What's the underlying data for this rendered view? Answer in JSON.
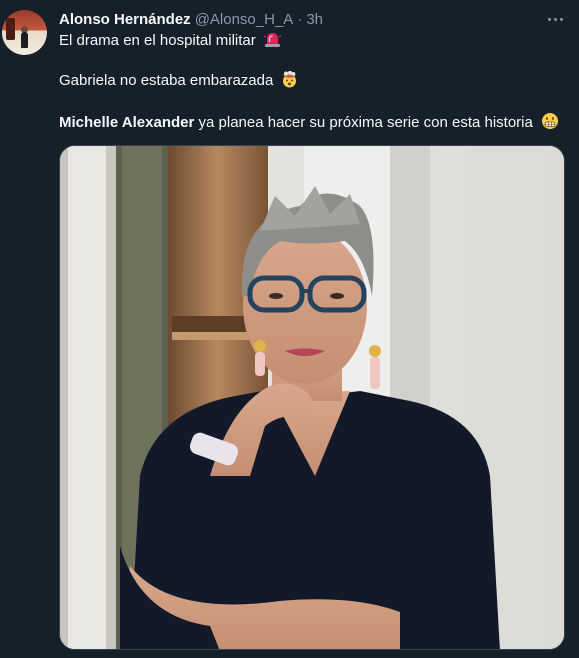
{
  "tweet": {
    "author_name": "Alonso Hernández",
    "handle": "@Alonso_H_A",
    "separator": "·",
    "time": "3h",
    "line1_text": "El drama en el hospital militar",
    "line1_emoji": "police-light-emoji",
    "line2_text": "Gabriela no estaba embarazada",
    "line2_emoji": "exploding-head-emoji",
    "line3_bold": "Michelle Alexander",
    "line3_text": " ya planea hacer su próxima serie con esta historia",
    "line3_emoji": "grimacing-face-emoji"
  },
  "colors": {
    "background": "#15202b",
    "text_primary": "#f7f9f9",
    "text_secondary": "#8b98a5",
    "media_border": "#38444d"
  },
  "media": {
    "icon": "photo-of-woman-with-glasses"
  }
}
